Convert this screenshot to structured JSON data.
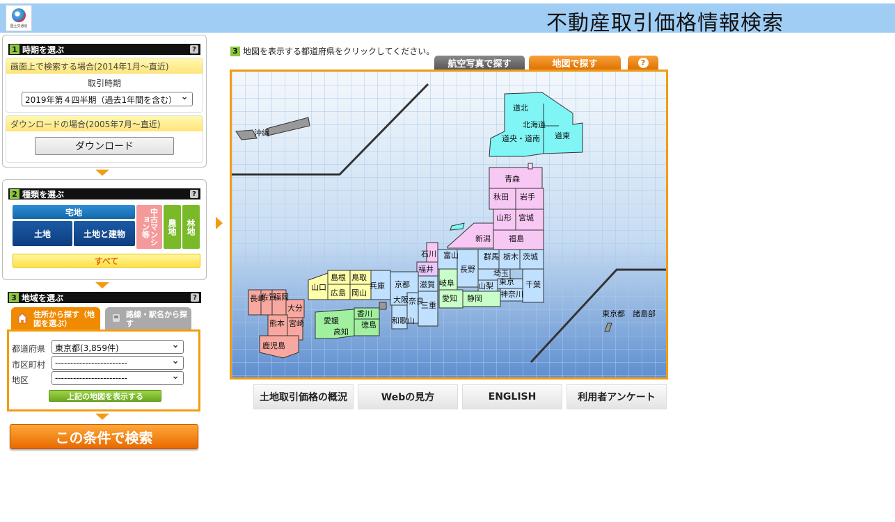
{
  "header": {
    "logo_text": "国土交通省",
    "title": "不動産取引価格情報検索"
  },
  "step1": {
    "num": "1",
    "title": "時期を選ぶ",
    "help": "?",
    "screen_label": "画面上で検索する場合(2014年1月～直近)",
    "period_label": "取引時期",
    "period_value": "2019年第４四半期（過去1年間を含む）",
    "download_label": "ダウンロードの場合(2005年7月～直近)",
    "download_button": "ダウンロード"
  },
  "step2": {
    "num": "2",
    "title": "種類を選ぶ",
    "help": "?",
    "takuchi": "宅地",
    "tochi": "土地",
    "tochi_tatemono": "土地と建物",
    "mansion": "中古マンション等",
    "nouchi": "農地",
    "rinchi": "林地",
    "all": "すべて"
  },
  "step3": {
    "num": "3",
    "title": "地域を選ぶ",
    "help": "?",
    "tab_address": "住所から探す（地図を選ぶ）",
    "tab_station": "路線・駅名から探す",
    "pref_label": "都道府県",
    "pref_value": "東京都(3,859件)",
    "city_label": "市区町村",
    "city_value": "------------------------",
    "district_label": "地区",
    "district_value": "------------------------",
    "show_map_button": "上記の地図を表示する"
  },
  "search_button": "この条件で検索",
  "map": {
    "num": "3",
    "instruction": "地図を表示する都道府県をクリックしてください。",
    "tab_aerial": "航空写真で探す",
    "tab_map": "地図で探す",
    "tab_help": "?",
    "labels": {
      "dohoku": "道北",
      "hokkaido": "北海道",
      "doo": "道央・道南",
      "dotou": "道東",
      "aomori": "青森",
      "akita": "秋田",
      "iwate": "岩手",
      "yamagata": "山形",
      "miyagi": "宮城",
      "niigata": "新潟",
      "fukushima": "福島",
      "ishikawa": "石川",
      "toyama": "富山",
      "fukui": "福井",
      "nagano": "長野",
      "gunma": "群馬",
      "tochigi": "栃木",
      "ibaraki": "茨城",
      "saitama": "埼玉",
      "tokyo": "東京",
      "kanagawa": "神奈川",
      "chiba": "千葉",
      "yamanashi": "山梨",
      "gifu": "岐阜",
      "shizuoka": "静岡",
      "aichi": "愛知",
      "shiga": "滋賀",
      "kyoto": "京都",
      "mie": "三重",
      "nara": "奈良",
      "osaka": "大阪",
      "wakayama": "和歌山",
      "hyogo": "兵庫",
      "tottori": "鳥取",
      "shimane": "島根",
      "okayama": "岡山",
      "hiroshima": "広島",
      "yamaguchi": "山口",
      "kagawa": "香川",
      "tokushima": "徳島",
      "ehime": "愛媛",
      "kochi": "高知",
      "fukuoka": "福岡",
      "saga": "佐賀",
      "nagasaki": "長崎",
      "oita": "大分",
      "kumamoto": "熊本",
      "miyazaki": "宮崎",
      "kagoshima": "鹿児島",
      "okinawa": "沖縄",
      "tokyo_islands": "東京都　諸島部"
    }
  },
  "footer": {
    "overview": "土地取引価格の概況",
    "howto": "Webの見方",
    "english": "ENGLISH",
    "survey": "利用者アンケート"
  }
}
